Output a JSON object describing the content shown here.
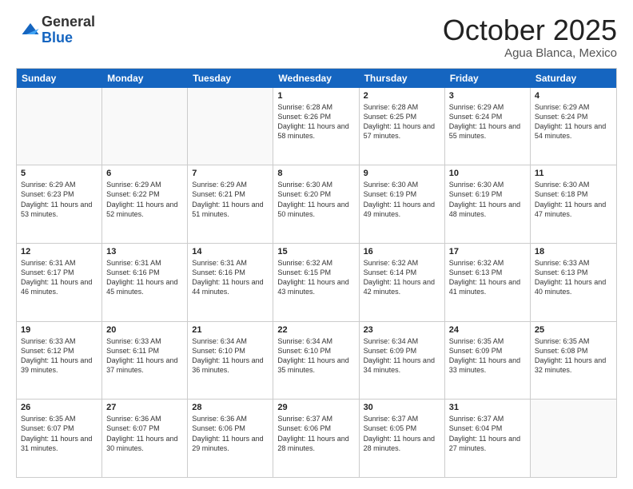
{
  "logo": {
    "general": "General",
    "blue": "Blue"
  },
  "header": {
    "month": "October 2025",
    "location": "Agua Blanca, Mexico"
  },
  "days_of_week": [
    "Sunday",
    "Monday",
    "Tuesday",
    "Wednesday",
    "Thursday",
    "Friday",
    "Saturday"
  ],
  "weeks": [
    [
      {
        "day": "",
        "empty": true
      },
      {
        "day": "",
        "empty": true
      },
      {
        "day": "",
        "empty": true
      },
      {
        "day": "1",
        "sunrise": "6:28 AM",
        "sunset": "6:26 PM",
        "daylight": "11 hours and 58 minutes."
      },
      {
        "day": "2",
        "sunrise": "6:28 AM",
        "sunset": "6:25 PM",
        "daylight": "11 hours and 57 minutes."
      },
      {
        "day": "3",
        "sunrise": "6:29 AM",
        "sunset": "6:24 PM",
        "daylight": "11 hours and 55 minutes."
      },
      {
        "day": "4",
        "sunrise": "6:29 AM",
        "sunset": "6:24 PM",
        "daylight": "11 hours and 54 minutes."
      }
    ],
    [
      {
        "day": "5",
        "sunrise": "6:29 AM",
        "sunset": "6:23 PM",
        "daylight": "11 hours and 53 minutes."
      },
      {
        "day": "6",
        "sunrise": "6:29 AM",
        "sunset": "6:22 PM",
        "daylight": "11 hours and 52 minutes."
      },
      {
        "day": "7",
        "sunrise": "6:29 AM",
        "sunset": "6:21 PM",
        "daylight": "11 hours and 51 minutes."
      },
      {
        "day": "8",
        "sunrise": "6:30 AM",
        "sunset": "6:20 PM",
        "daylight": "11 hours and 50 minutes."
      },
      {
        "day": "9",
        "sunrise": "6:30 AM",
        "sunset": "6:19 PM",
        "daylight": "11 hours and 49 minutes."
      },
      {
        "day": "10",
        "sunrise": "6:30 AM",
        "sunset": "6:19 PM",
        "daylight": "11 hours and 48 minutes."
      },
      {
        "day": "11",
        "sunrise": "6:30 AM",
        "sunset": "6:18 PM",
        "daylight": "11 hours and 47 minutes."
      }
    ],
    [
      {
        "day": "12",
        "sunrise": "6:31 AM",
        "sunset": "6:17 PM",
        "daylight": "11 hours and 46 minutes."
      },
      {
        "day": "13",
        "sunrise": "6:31 AM",
        "sunset": "6:16 PM",
        "daylight": "11 hours and 45 minutes."
      },
      {
        "day": "14",
        "sunrise": "6:31 AM",
        "sunset": "6:16 PM",
        "daylight": "11 hours and 44 minutes."
      },
      {
        "day": "15",
        "sunrise": "6:32 AM",
        "sunset": "6:15 PM",
        "daylight": "11 hours and 43 minutes."
      },
      {
        "day": "16",
        "sunrise": "6:32 AM",
        "sunset": "6:14 PM",
        "daylight": "11 hours and 42 minutes."
      },
      {
        "day": "17",
        "sunrise": "6:32 AM",
        "sunset": "6:13 PM",
        "daylight": "11 hours and 41 minutes."
      },
      {
        "day": "18",
        "sunrise": "6:33 AM",
        "sunset": "6:13 PM",
        "daylight": "11 hours and 40 minutes."
      }
    ],
    [
      {
        "day": "19",
        "sunrise": "6:33 AM",
        "sunset": "6:12 PM",
        "daylight": "11 hours and 39 minutes."
      },
      {
        "day": "20",
        "sunrise": "6:33 AM",
        "sunset": "6:11 PM",
        "daylight": "11 hours and 37 minutes."
      },
      {
        "day": "21",
        "sunrise": "6:34 AM",
        "sunset": "6:10 PM",
        "daylight": "11 hours and 36 minutes."
      },
      {
        "day": "22",
        "sunrise": "6:34 AM",
        "sunset": "6:10 PM",
        "daylight": "11 hours and 35 minutes."
      },
      {
        "day": "23",
        "sunrise": "6:34 AM",
        "sunset": "6:09 PM",
        "daylight": "11 hours and 34 minutes."
      },
      {
        "day": "24",
        "sunrise": "6:35 AM",
        "sunset": "6:09 PM",
        "daylight": "11 hours and 33 minutes."
      },
      {
        "day": "25",
        "sunrise": "6:35 AM",
        "sunset": "6:08 PM",
        "daylight": "11 hours and 32 minutes."
      }
    ],
    [
      {
        "day": "26",
        "sunrise": "6:35 AM",
        "sunset": "6:07 PM",
        "daylight": "11 hours and 31 minutes."
      },
      {
        "day": "27",
        "sunrise": "6:36 AM",
        "sunset": "6:07 PM",
        "daylight": "11 hours and 30 minutes."
      },
      {
        "day": "28",
        "sunrise": "6:36 AM",
        "sunset": "6:06 PM",
        "daylight": "11 hours and 29 minutes."
      },
      {
        "day": "29",
        "sunrise": "6:37 AM",
        "sunset": "6:06 PM",
        "daylight": "11 hours and 28 minutes."
      },
      {
        "day": "30",
        "sunrise": "6:37 AM",
        "sunset": "6:05 PM",
        "daylight": "11 hours and 28 minutes."
      },
      {
        "day": "31",
        "sunrise": "6:37 AM",
        "sunset": "6:04 PM",
        "daylight": "11 hours and 27 minutes."
      },
      {
        "day": "",
        "empty": true
      }
    ]
  ]
}
